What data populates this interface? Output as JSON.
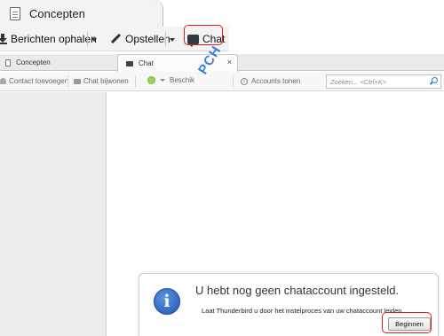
{
  "top_tab": {
    "label": "Concepten",
    "icon": "document-icon"
  },
  "top_toolbar": {
    "get_messages_label": "Berichten ophalen",
    "compose_label": "Opstellen",
    "chat_label": "Chat",
    "highlight_color": "#e11b1b"
  },
  "tabs": [
    {
      "label": "Concepten",
      "icon": "document-icon",
      "active": false
    },
    {
      "label": "Chat",
      "icon": "chat-icon",
      "active": true,
      "close": "×"
    }
  ],
  "chat_toolbar": {
    "add_contact_label": "Contact toevoegen",
    "join_chat_label": "Chat bijwonen",
    "status_label": "Beschikbaar",
    "status_color": "#9bd35a",
    "show_accounts_label": "Accounts tonen",
    "search_placeholder": "Zoeken... <Ctrl+K>"
  },
  "watermark": "PCH",
  "notice": {
    "title": "U hebt nog geen chataccount ingesteld.",
    "body": "Laat Thunderbird u door het instelproces van uw chataccount leiden.",
    "button_label": "Beginnen",
    "icon": "info-icon"
  }
}
